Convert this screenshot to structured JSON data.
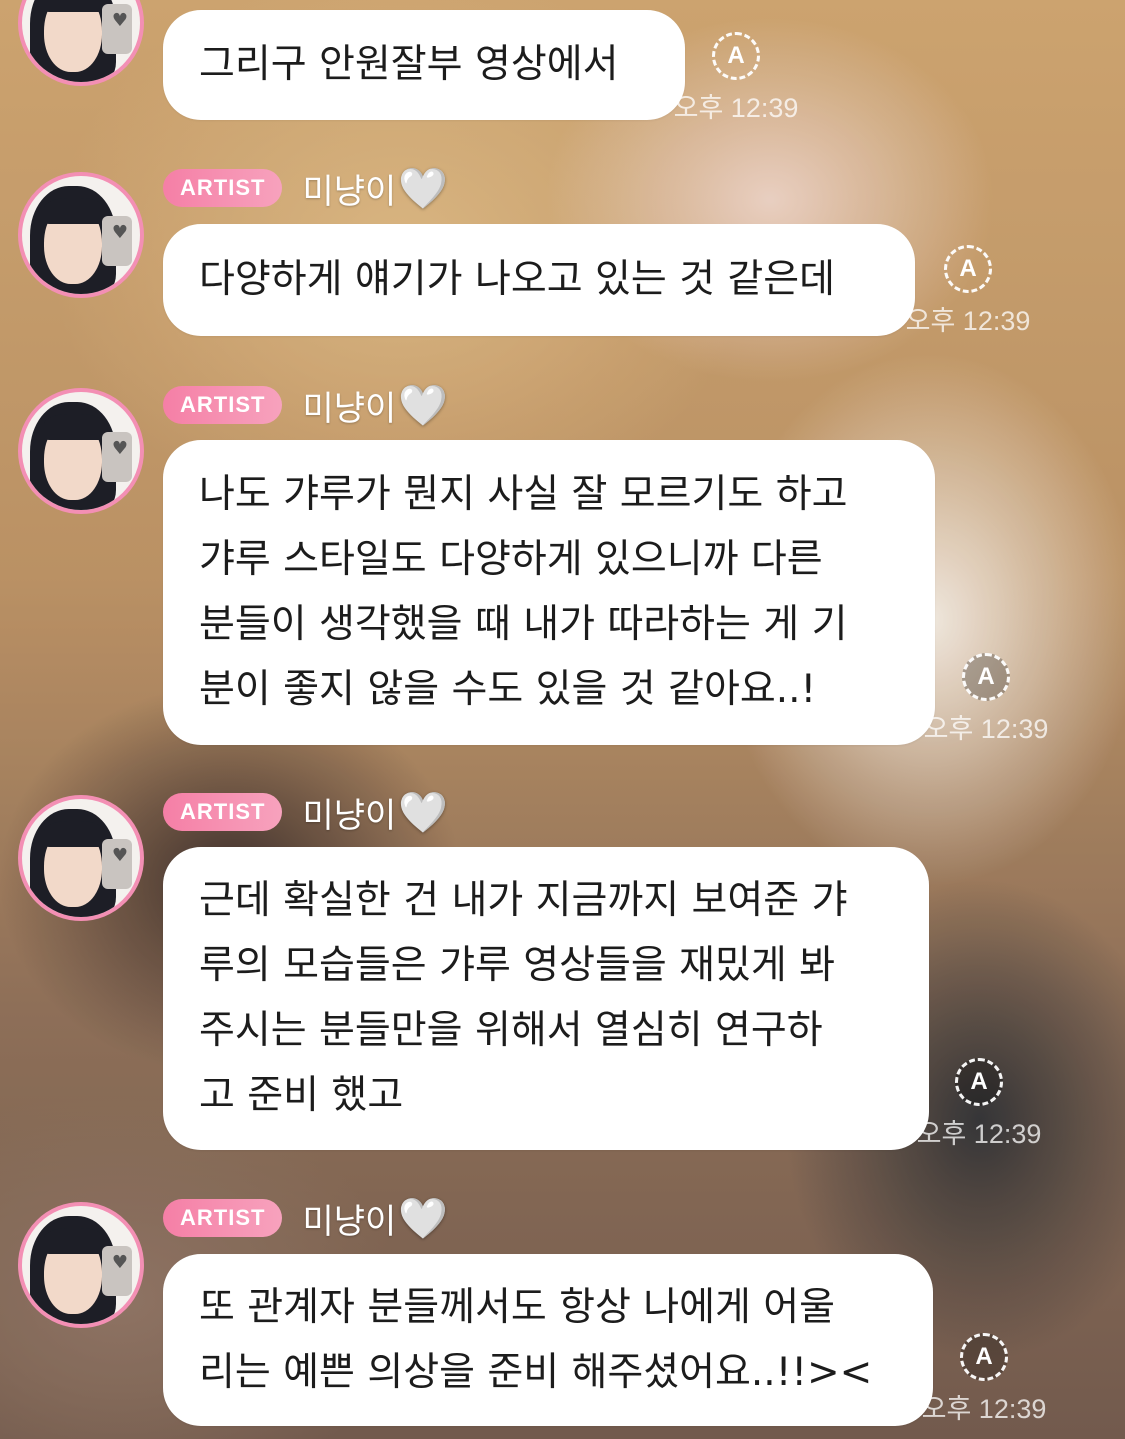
{
  "messages": [
    {
      "badge": "",
      "name": "",
      "heart": "",
      "lines": [
        "그리구 안원잘부 영상에서"
      ],
      "translate_icon": "A",
      "time": "오후 12:39"
    },
    {
      "badge": "ARTIST",
      "name": "미냥이",
      "heart": "🤍",
      "lines": [
        "다양하게 얘기가 나오고 있는 것 같은데"
      ],
      "translate_icon": "A",
      "time": "오후 12:39"
    },
    {
      "badge": "ARTIST",
      "name": "미냥이",
      "heart": "🤍",
      "lines": [
        "나도 갸루가 뭔지 사실 잘 모르기도 하고",
        "갸루 스타일도 다양하게 있으니까 다른",
        "분들이 생각했을 때 내가 따라하는 게 기",
        "분이 좋지 않을 수도 있을 것 같아요..!"
      ],
      "translate_icon": "A",
      "time": "오후 12:39"
    },
    {
      "badge": "ARTIST",
      "name": "미냥이",
      "heart": "🤍",
      "lines": [
        "근데 확실한 건 내가 지금까지 보여준 갸",
        "루의 모습들은 갸루 영상들을 재밌게 봐",
        "주시는 분들만을 위해서 열심히 연구하",
        "고 준비 했고"
      ],
      "translate_icon": "A",
      "time": "오후 12:39"
    },
    {
      "badge": "ARTIST",
      "name": "미냥이",
      "heart": "🤍",
      "lines": [
        "또 관계자 분들께서도 항상 나에게 어울",
        "리는 예쁜 의상을 준비 해주셨어요..!!><"
      ],
      "translate_icon": "A",
      "time": "오후 12:39"
    }
  ],
  "colors": {
    "badge": "#f57fa6",
    "avatar_ring": "#f38fb4",
    "bubble": "#ffffff",
    "text": "#1c1c1c"
  }
}
